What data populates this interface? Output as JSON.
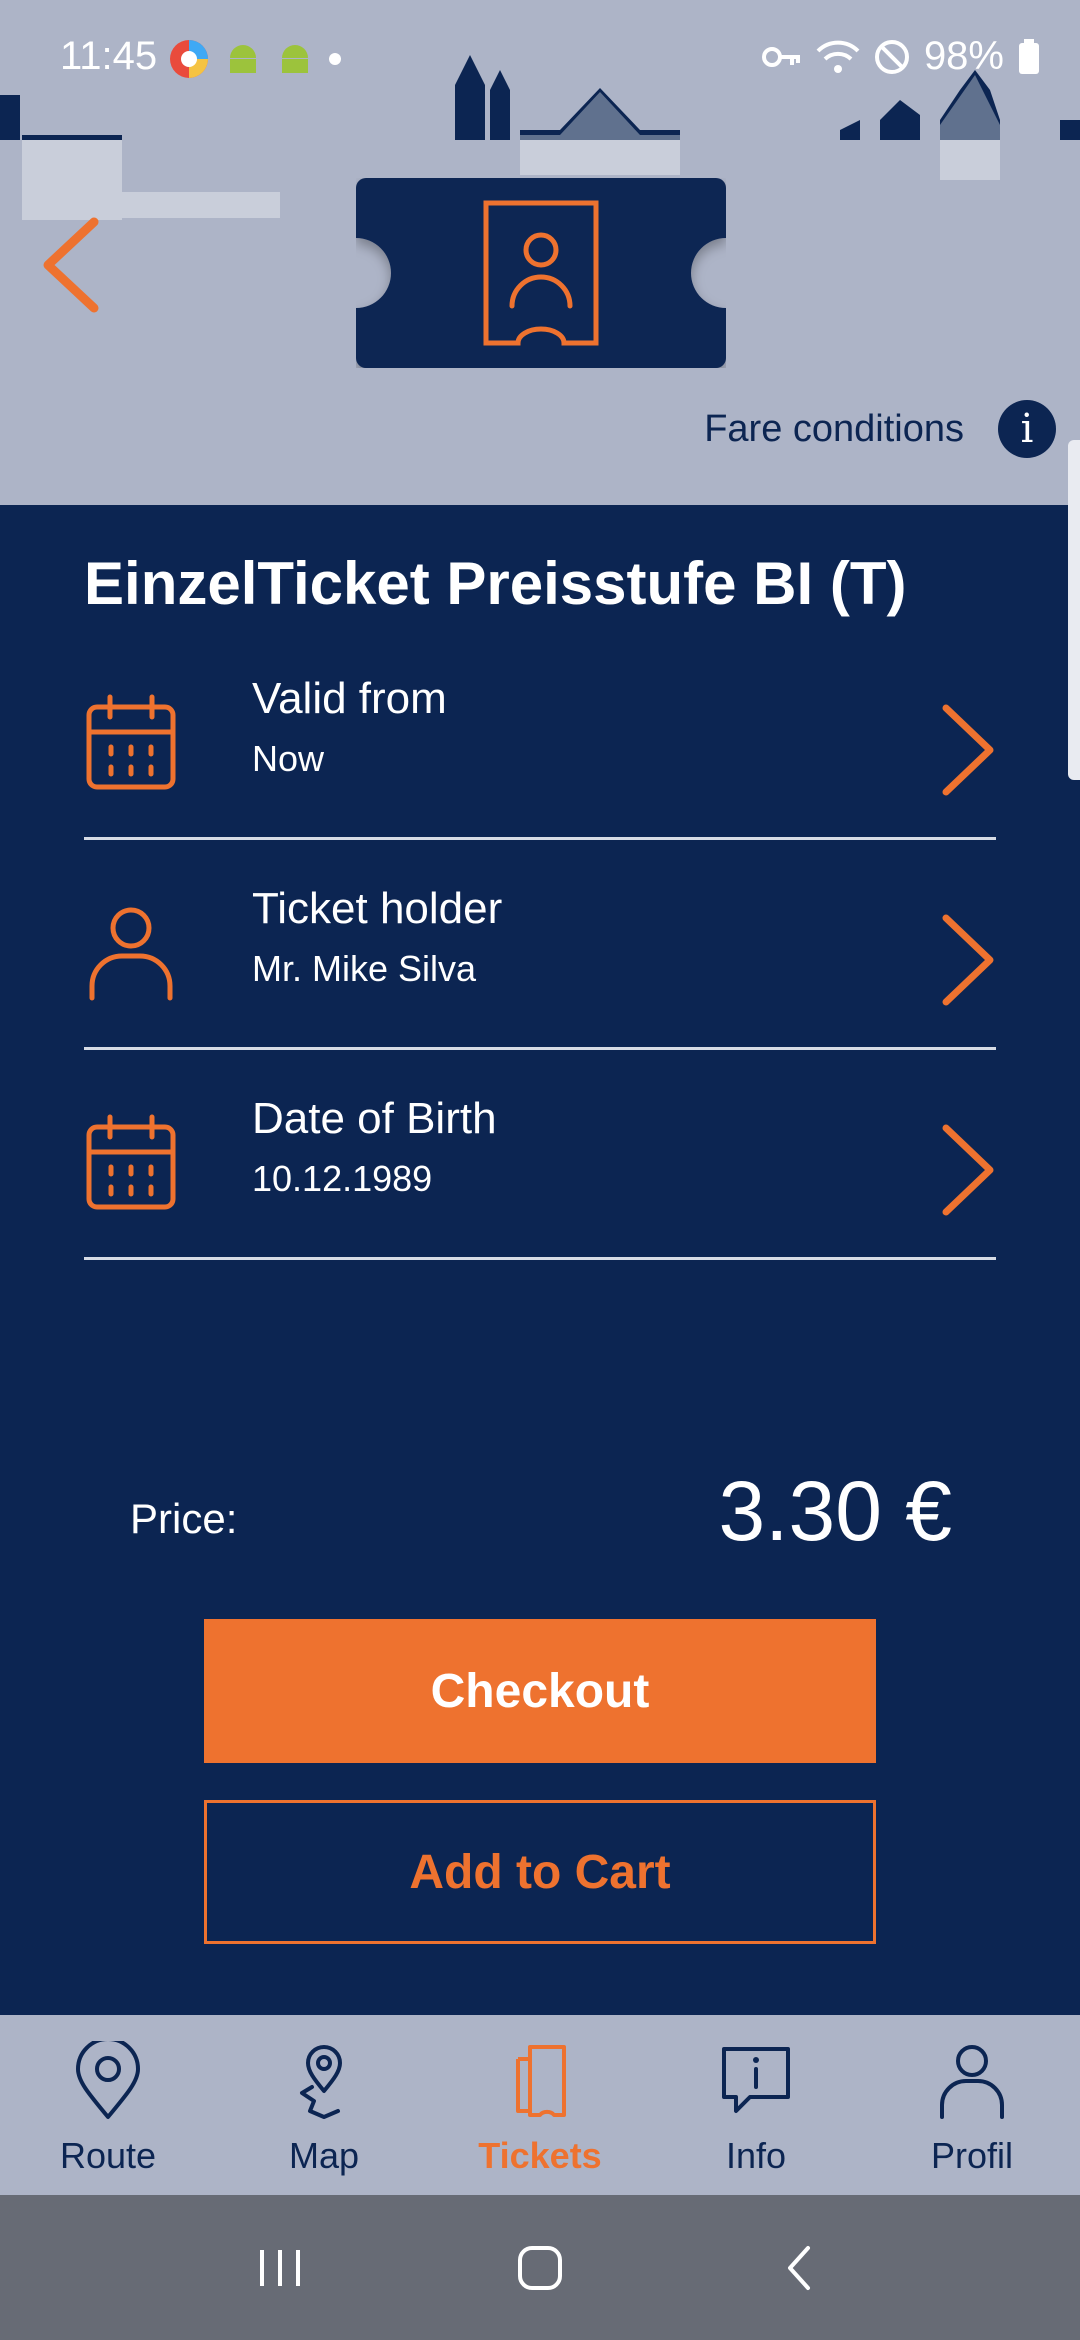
{
  "status_bar": {
    "time": "11:45",
    "battery": "98%"
  },
  "header": {
    "fare_conditions_label": "Fare conditions",
    "info_glyph": "i"
  },
  "ticket": {
    "title": "EinzelTicket Preisstufe BI (T)"
  },
  "fields": [
    {
      "label": "Valid from",
      "value": "Now",
      "icon": "calendar-icon"
    },
    {
      "label": "Ticket holder",
      "value": "Mr. Mike Silva",
      "icon": "person-icon"
    },
    {
      "label": "Date of Birth",
      "value": "10.12.1989",
      "icon": "calendar-icon"
    }
  ],
  "price": {
    "label": "Price:",
    "value": "3.30 €"
  },
  "buttons": {
    "checkout": "Checkout",
    "add_to_cart": "Add to Cart"
  },
  "bottom_nav": [
    {
      "label": "Route",
      "icon": "location-pin-icon",
      "active": false
    },
    {
      "label": "Map",
      "icon": "map-pin-icon",
      "active": false
    },
    {
      "label": "Tickets",
      "icon": "tickets-icon",
      "active": true
    },
    {
      "label": "Info",
      "icon": "info-bubble-icon",
      "active": false
    },
    {
      "label": "Profil",
      "icon": "profile-icon",
      "active": false
    }
  ],
  "colors": {
    "navy": "#0c2552",
    "orange": "#ee722f",
    "header_gray": "#adb4c7"
  }
}
